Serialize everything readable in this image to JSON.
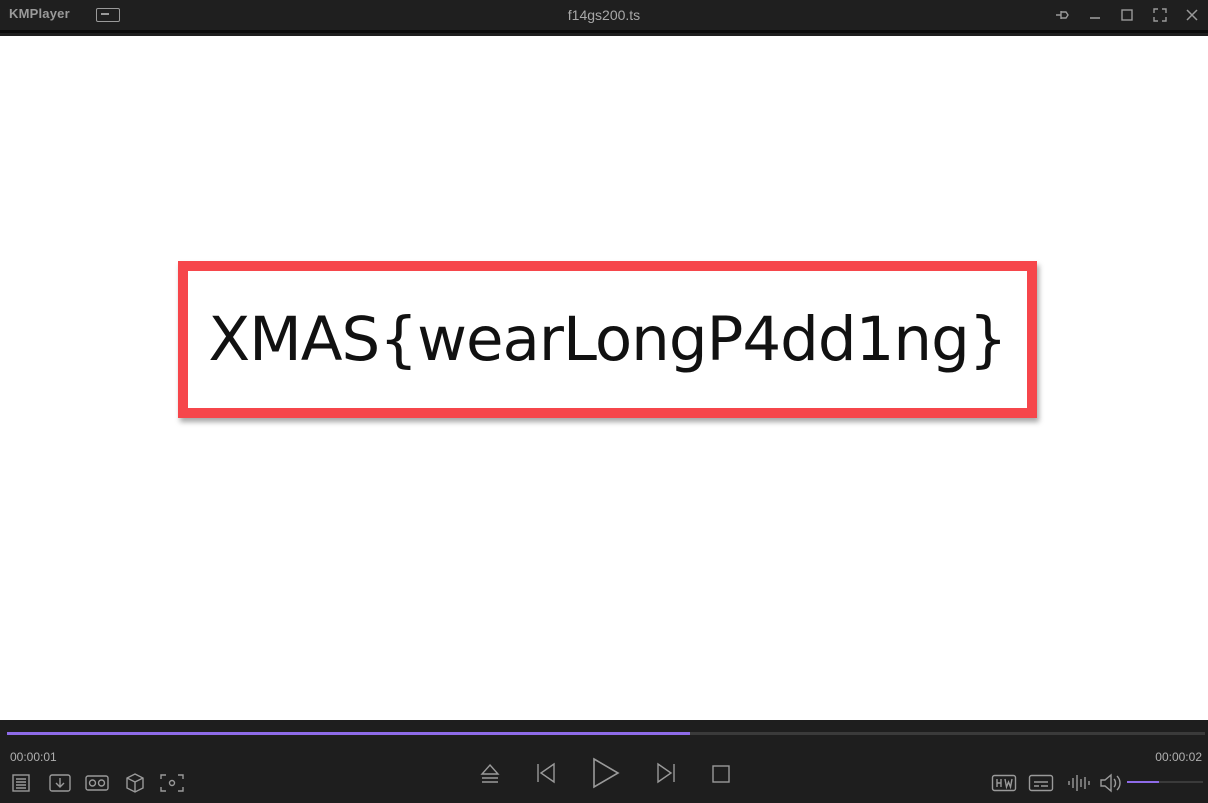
{
  "app": {
    "name": "KMPlayer",
    "file_title": "f14gs200.ts"
  },
  "video": {
    "flag_text": "XMAS{wearLongP4dd1ng}"
  },
  "playback": {
    "current_time": "00:00:01",
    "total_time": "00:00:02",
    "progress_fraction": 0.57,
    "volume_fraction": 0.42
  },
  "colors": {
    "accent": "#8e6be8",
    "flag_border": "#f6464b"
  },
  "icons": {
    "titlebar": [
      "mini-mode-icon",
      "pin-icon",
      "minimize-icon",
      "maximize-icon",
      "fullscreen-icon",
      "close-icon"
    ],
    "left_controls": [
      "playlist-icon",
      "download-icon",
      "vr-icon",
      "3d-cube-icon",
      "capture-icon"
    ],
    "center_controls": [
      "eject-icon",
      "previous-icon",
      "play-icon",
      "next-icon",
      "stop-icon"
    ],
    "right_controls": [
      "hw-accel-icon",
      "subtitle-icon",
      "equalizer-icon",
      "volume-icon"
    ]
  }
}
